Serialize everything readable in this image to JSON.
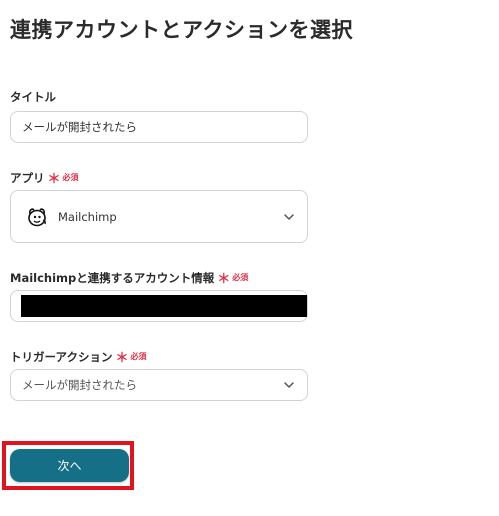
{
  "page": {
    "title": "連携アカウントとアクションを選択"
  },
  "colors": {
    "accent": "#156f86",
    "required": "#e0324b",
    "highlight": "#e0141e"
  },
  "required_label": {
    "mark": "＊",
    "text": "必須"
  },
  "fields": {
    "title": {
      "label": "タイトル",
      "value": "メールが開封されたら"
    },
    "app": {
      "label": "アプリ",
      "value": "Mailchimp",
      "icon": "mailchimp-icon"
    },
    "account": {
      "label": "Mailchimpと連携するアカウント情報"
    },
    "trigger": {
      "label": "トリガーアクション",
      "value": "メールが開封されたら"
    }
  },
  "footer": {
    "next_label": "次へ"
  }
}
